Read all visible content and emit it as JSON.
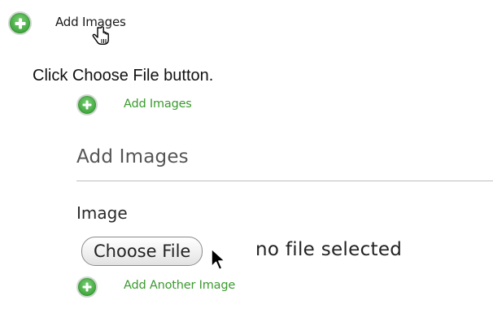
{
  "top_link": {
    "label": "Add Images",
    "icon": "plus-circle-icon"
  },
  "instruction": "Click Choose File button.",
  "panel": {
    "add_images_link": "Add Images",
    "section_title": "Add Images",
    "image_label": "Image",
    "choose_file_label": "Choose File",
    "file_status": "no file selected",
    "add_another_link": "Add Another Image"
  },
  "colors": {
    "link_green": "#3a9a2e",
    "icon_green": "#3ea83b",
    "divider": "#bdbdbd"
  }
}
